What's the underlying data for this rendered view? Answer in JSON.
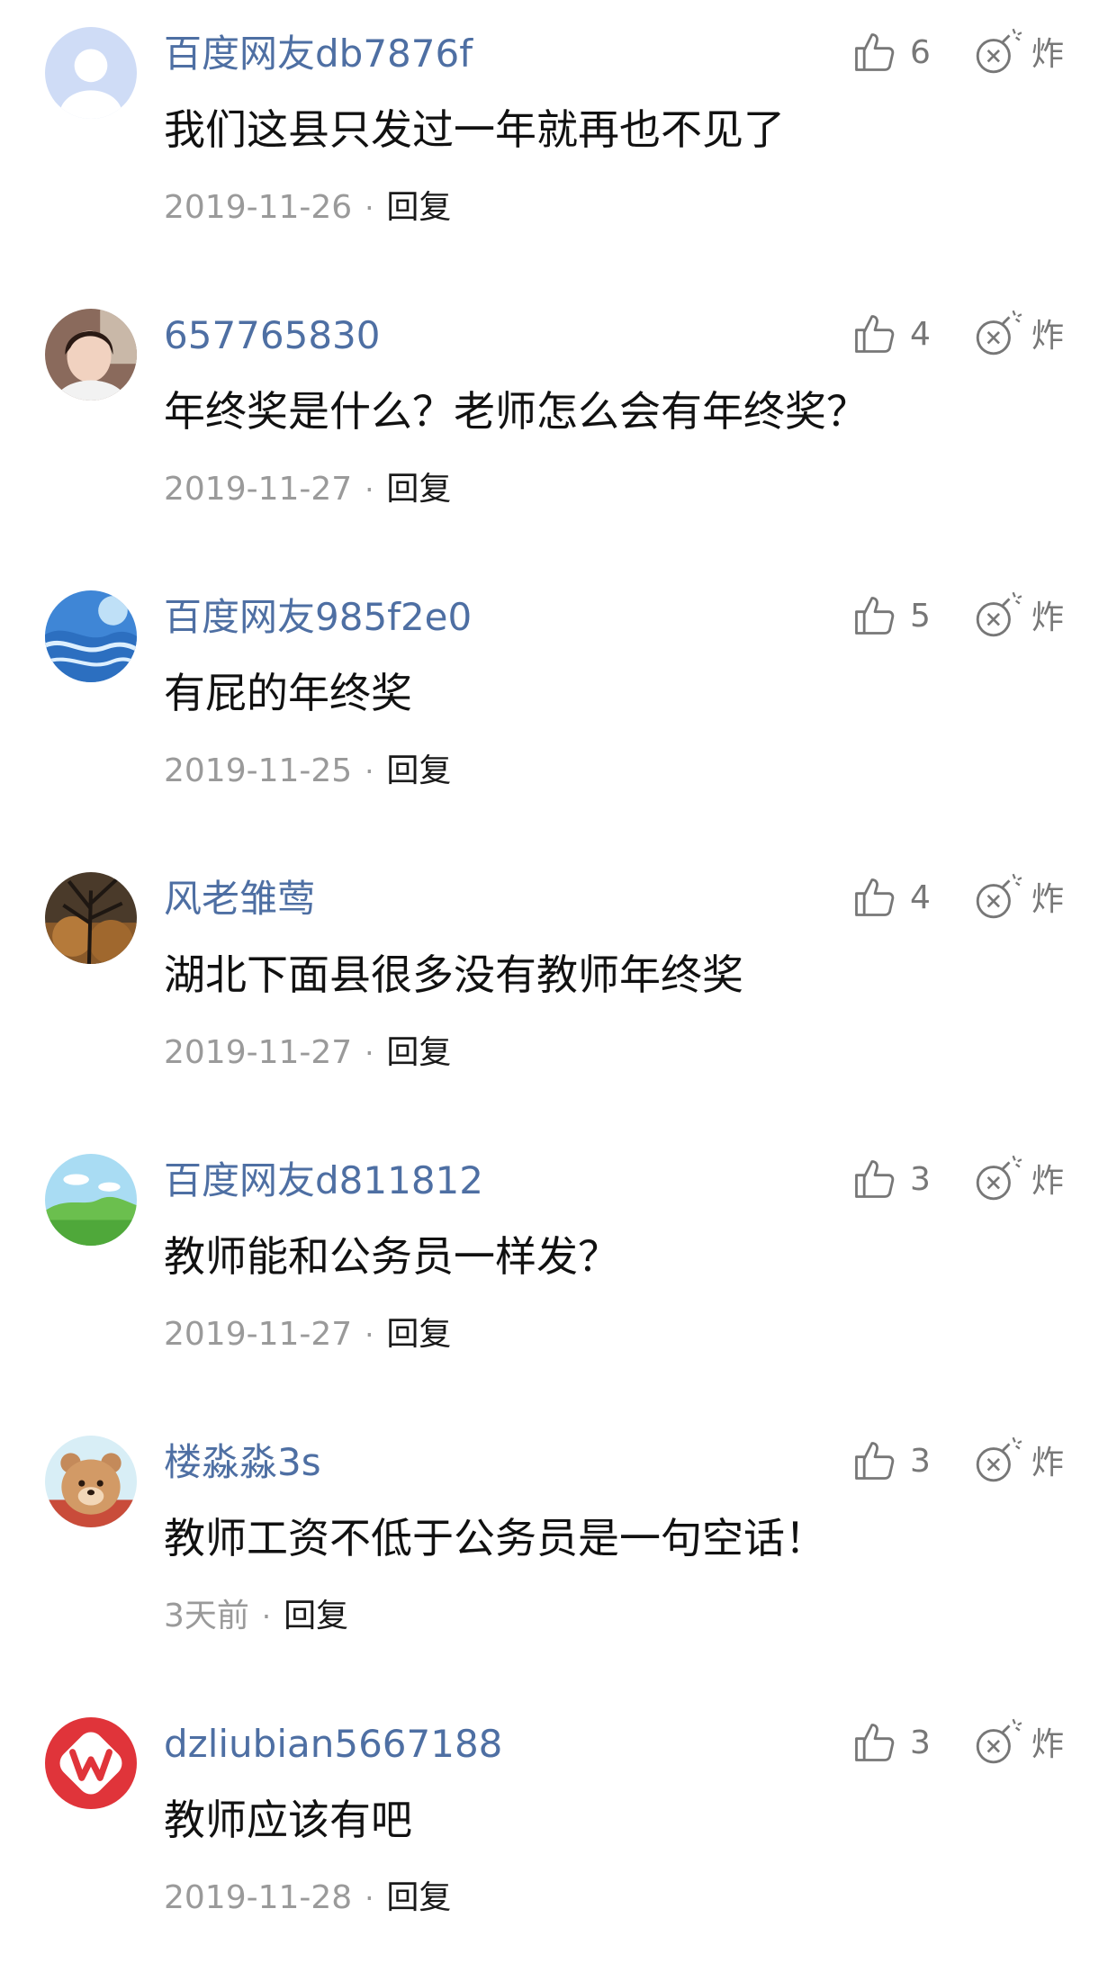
{
  "comments": [
    {
      "username": "百度网友db7876f",
      "content": "我们这县只发过一年就再也不见了",
      "time": "2019-11-26",
      "reply_label": "回复",
      "likes": "6",
      "bomb_label": "炸",
      "avatar": "default-avatar"
    },
    {
      "username": "657765830",
      "content": "年终奖是什么？老师怎么会有年终奖？",
      "time": "2019-11-27",
      "reply_label": "回复",
      "likes": "4",
      "bomb_label": "炸",
      "avatar": "photo-avatar"
    },
    {
      "username": "百度网友985f2e0",
      "content": "有屁的年终奖",
      "time": "2019-11-25",
      "reply_label": "回复",
      "likes": "5",
      "bomb_label": "炸",
      "avatar": "blue-swirl-avatar"
    },
    {
      "username": "风老雏莺",
      "content": "湖北下面县很多没有教师年终奖",
      "time": "2019-11-27",
      "reply_label": "回复",
      "likes": "4",
      "bomb_label": "炸",
      "avatar": "tree-avatar"
    },
    {
      "username": "百度网友d811812",
      "content": "教师能和公务员一样发？",
      "time": "2019-11-27",
      "reply_label": "回复",
      "likes": "3",
      "bomb_label": "炸",
      "avatar": "landscape-avatar"
    },
    {
      "username": "楼淼淼3s",
      "content": "教师工资不低于公务员是一句空话！",
      "time": "3天前",
      "reply_label": "回复",
      "likes": "3",
      "bomb_label": "炸",
      "avatar": "bear-avatar"
    },
    {
      "username": "dzliubian5667188",
      "content": "教师应该有吧",
      "time": "2019-11-28",
      "reply_label": "回复",
      "likes": "3",
      "bomb_label": "炸",
      "avatar": "wps-logo-avatar"
    }
  ],
  "colors": {
    "username": "#4e6fa3",
    "content": "#111111",
    "meta": "#9a9a9a",
    "icon": "#777777"
  }
}
